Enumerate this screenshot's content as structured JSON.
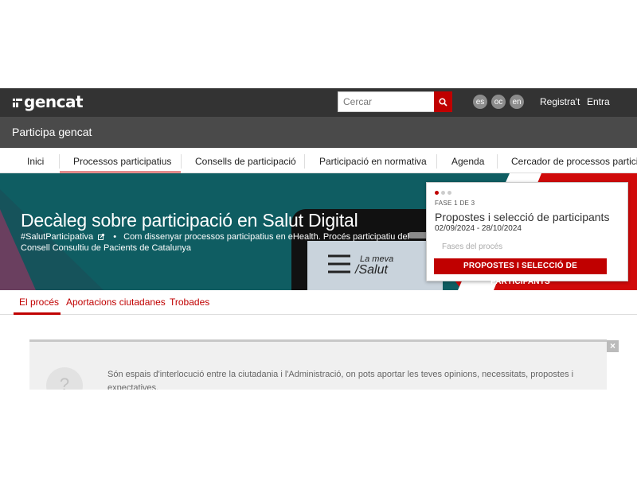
{
  "header": {
    "logo_text": "gencat",
    "search_placeholder": "Cercar",
    "languages": [
      "es",
      "oc",
      "en"
    ],
    "register_label": "Registra't",
    "login_label": "Entra"
  },
  "subheader": {
    "title": "Participa gencat"
  },
  "nav": {
    "items": [
      "Inici",
      "Processos participatius",
      "Consells de participació",
      "Participació en normativa",
      "Agenda",
      "Cercador de processos participatius"
    ],
    "active_index": 1
  },
  "hero": {
    "title": "Decàleg sobre participació en Salut Digital",
    "hashtag": "#SalutParticipativa",
    "description_line1": "Com dissenyar processos participatius en eHealth. Procés participatiu del",
    "description_line2": "Consell Consultiu de Pacients de Catalunya",
    "phone_text_small": "La meva",
    "phone_text_large": "/Salut"
  },
  "phase_card": {
    "phase_label": "FASE 1 DE 3",
    "title": "Propostes i selecció de participants",
    "dates": "02/09/2024 - 28/10/2024",
    "phases_link": "Fases del procés",
    "button_label": "PROPOSTES I SELECCIÓ DE PARTICIPANTS",
    "total_phases": 3,
    "current_phase": 1
  },
  "tabs": {
    "items": [
      "El procés",
      "Aportacions ciutadanes",
      "Trobades"
    ],
    "active_index": 0
  },
  "info_box": {
    "icon_glyph": "?",
    "text": "Són espais d'interlocució entre la ciutadania i l'Administració, on pots aportar les teves opinions, necessitats, propostes i expectatives.",
    "close_glyph": "×"
  },
  "colors": {
    "accent": "#c00000",
    "topbar": "#333333",
    "subbar": "#4a4a4a",
    "hero_bg": "#0f5d62"
  }
}
